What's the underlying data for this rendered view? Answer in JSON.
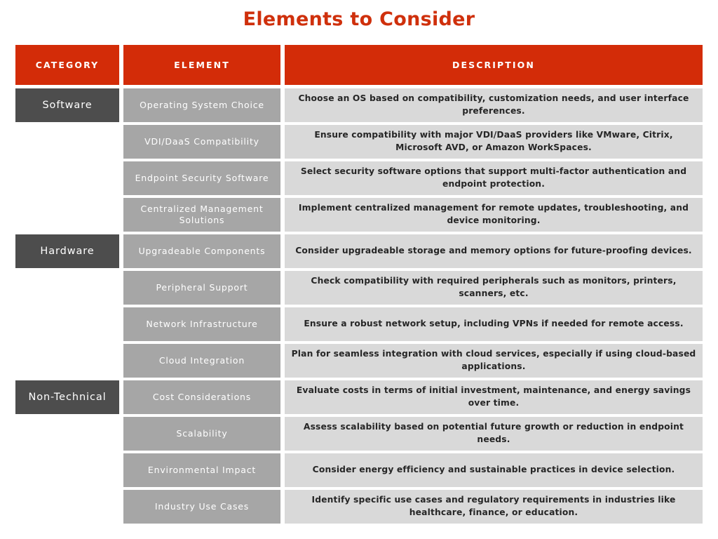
{
  "title": "Elements to Consider",
  "theme": {
    "header_red": "#d32c08",
    "category_gray": "#4d4d4d",
    "element_gray": "#a6a6a6",
    "description_gray": "#d9d9d9",
    "title_color": "#cf300c",
    "page_background": "#ffffff"
  },
  "table": {
    "headers": {
      "category": "CATEGORY",
      "element": "ELEMENT",
      "description": "DESCRIPTION"
    },
    "rows": [
      {
        "category": "Software",
        "element": "Operating System Choice",
        "description": "Choose an OS based on compatibility, customization needs, and user interface preferences."
      },
      {
        "category": "",
        "element": "VDI/DaaS Compatibility",
        "description": "Ensure compatibility with major VDI/DaaS providers like VMware, Citrix, Microsoft AVD, or Amazon WorkSpaces."
      },
      {
        "category": "",
        "element": "Endpoint Security Software",
        "description": "Select security software options that support multi-factor authentication and endpoint protection."
      },
      {
        "category": "",
        "element": "Centralized Management Solutions",
        "description": "Implement centralized management for remote updates, troubleshooting, and device monitoring."
      },
      {
        "category": "Hardware",
        "element": "Upgradeable Components",
        "description": "Consider upgradeable storage and memory options for future-proofing devices."
      },
      {
        "category": "",
        "element": "Peripheral Support",
        "description": "Check compatibility with required peripherals such as monitors, printers, scanners, etc."
      },
      {
        "category": "",
        "element": "Network Infrastructure",
        "description": "Ensure a robust network setup, including VPNs if needed for remote access."
      },
      {
        "category": "",
        "element": "Cloud Integration",
        "description": "Plan for seamless integration with cloud services, especially if using cloud-based applications."
      },
      {
        "category": "Non-Technical",
        "element": "Cost Considerations",
        "description": "Evaluate costs in terms of initial investment, maintenance, and energy savings over time."
      },
      {
        "category": "",
        "element": "Scalability",
        "description": "Assess scalability based on potential future growth or reduction in endpoint needs."
      },
      {
        "category": "",
        "element": "Environmental Impact",
        "description": "Consider energy efficiency and sustainable practices in device selection."
      },
      {
        "category": "",
        "element": "Industry Use Cases",
        "description": "Identify specific use cases and regulatory requirements in industries like healthcare, finance, or education."
      }
    ]
  }
}
